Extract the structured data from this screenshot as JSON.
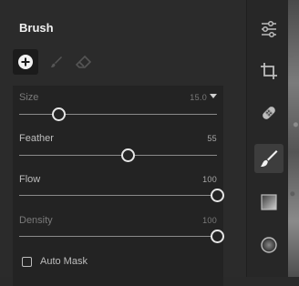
{
  "panel": {
    "title": "Brush",
    "tools": [
      {
        "name": "add-brush",
        "icon": "plus-circle-icon",
        "active": true
      },
      {
        "name": "brush",
        "icon": "brush-icon",
        "active": false
      },
      {
        "name": "eraser",
        "icon": "eraser-icon",
        "active": false
      }
    ],
    "sliders": [
      {
        "label": "Size",
        "value": "15.0",
        "level": 0.2,
        "dropdown": true,
        "dim": true
      },
      {
        "label": "Feather",
        "value": "55",
        "level": 0.55,
        "dropdown": false,
        "dim": false
      },
      {
        "label": "Flow",
        "value": "100",
        "level": 1.0,
        "dropdown": false,
        "dim": false
      },
      {
        "label": "Density",
        "value": "100",
        "level": 1.0,
        "dropdown": false,
        "dim": true
      }
    ],
    "auto_mask": {
      "label": "Auto Mask",
      "checked": false
    }
  },
  "rail": {
    "buttons": [
      {
        "name": "adjustments",
        "icon": "sliders-icon",
        "active": false
      },
      {
        "name": "crop",
        "icon": "crop-icon",
        "active": false
      },
      {
        "name": "heal",
        "icon": "bandage-icon",
        "active": false
      },
      {
        "name": "brush",
        "icon": "brush-icon",
        "active": true
      },
      {
        "name": "gradient",
        "icon": "gradient-square-icon",
        "active": false
      },
      {
        "name": "radial",
        "icon": "radial-circle-icon",
        "active": false
      }
    ]
  },
  "colors": {
    "accent": "#e6e6e6",
    "panel_bg": "#2b2b2b",
    "group_bg": "#232323"
  }
}
